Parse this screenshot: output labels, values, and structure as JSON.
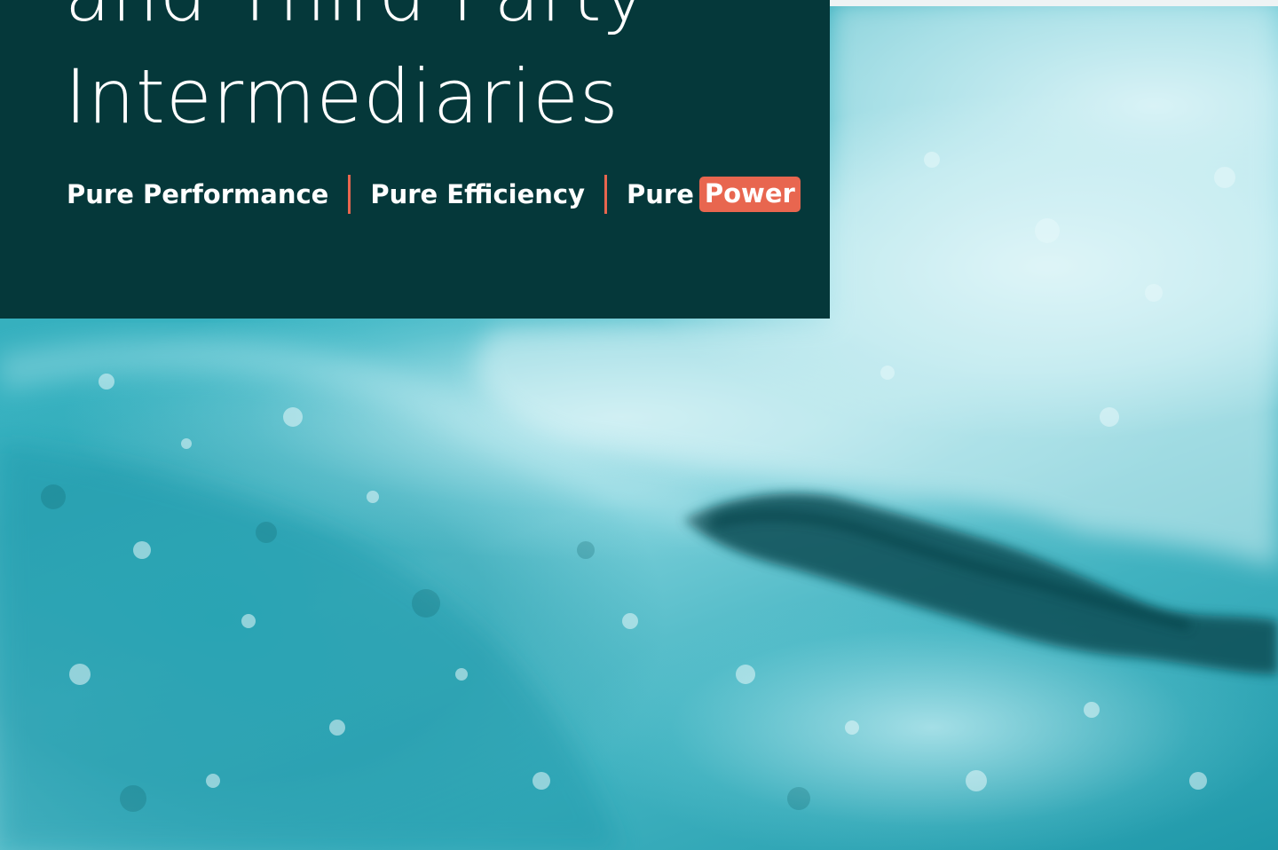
{
  "title": {
    "line1": "and Third Party",
    "line2": "Intermediaries"
  },
  "tagline": {
    "item1": "Pure Performance",
    "item2": "Pure Efficiency",
    "item3_prefix": "Pure",
    "item3_highlight": "Power"
  },
  "colors": {
    "panel": "#05383a",
    "accent": "#e8664f",
    "water": "#3fb6c3"
  },
  "background": {
    "icon": "ice-water-photo"
  }
}
